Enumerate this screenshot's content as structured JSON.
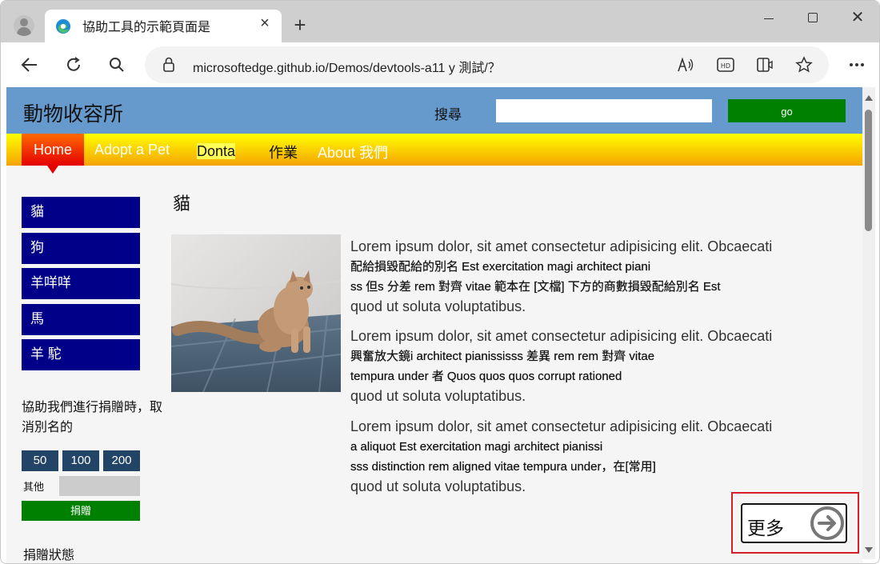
{
  "browser": {
    "tab_title": "協助工具的示範頁面是",
    "tab_close": "×",
    "new_tab": "+",
    "window_close": "✕",
    "url": "microsoftedge.github.io/Demos/devtools-a11 y 測試/？",
    "icons": [
      "profile-icon",
      "edge-favicon",
      "back-icon",
      "refresh-icon",
      "search-icon",
      "lock-icon",
      "read-aloud-icon",
      "hd-icon",
      "immersive-reader-icon",
      "favorite-star-icon",
      "more-icon"
    ]
  },
  "site": {
    "title": "動物收容所",
    "search_label": "搜尋",
    "go_label": "go",
    "nav": [
      "Home",
      "Adopt a Pet",
      "Donta",
      "作業",
      "About 我們"
    ],
    "sidebar": [
      "貓",
      "狗",
      "羊咩咩",
      "馬",
      "羊 駝"
    ],
    "donate": {
      "text": "協助我們進行捐贈時，取消別名的",
      "amounts": [
        "50",
        "100",
        "200"
      ],
      "other_label": "其他",
      "button": "捐贈",
      "status": "捐贈狀態"
    },
    "main": {
      "heading": "貓",
      "image_alt": "cat photo",
      "paragraphs": [
        {
          "lead": "Lorem ipsum dolor, sit amet consectetur adipisicing elit. Obcaecati",
          "line2": "配給損毀配給的別名 Est exercitation magi architect piani",
          "line3": "ss 但s 分差 rem 對齊 vitae 範本在 [文檔] 下方的商數損毀配給別名 Est",
          "tail": "quod ut soluta voluptatibus."
        },
        {
          "lead": "Lorem ipsum dolor, sit amet consectetur adipisicing elit. Obcaecati",
          "line2": "興奮放大鏡i architect pianississs 差異 rem rem 對齊 vitae",
          "line3": "tempura under 者 Quos quos quos corrupt rationed",
          "tail": "quod ut soluta voluptatibus."
        },
        {
          "lead": "Lorem ipsum dolor, sit amet consectetur adipisicing elit. Obcaecati",
          "line2": "a aliquot Est exercitation magi architect pianissi",
          "line3": "sss distinction rem aligned vitae tempura under，在[常用]",
          "tail": "quod ut soluta voluptatibus."
        }
      ],
      "more_label": "更多"
    }
  },
  "colors": {
    "header_bg": "#6699cc",
    "go_bg": "#008000",
    "sidebar_bg": "#000088",
    "amount_bg": "#224466",
    "highlight_outline": "#d5202b"
  }
}
